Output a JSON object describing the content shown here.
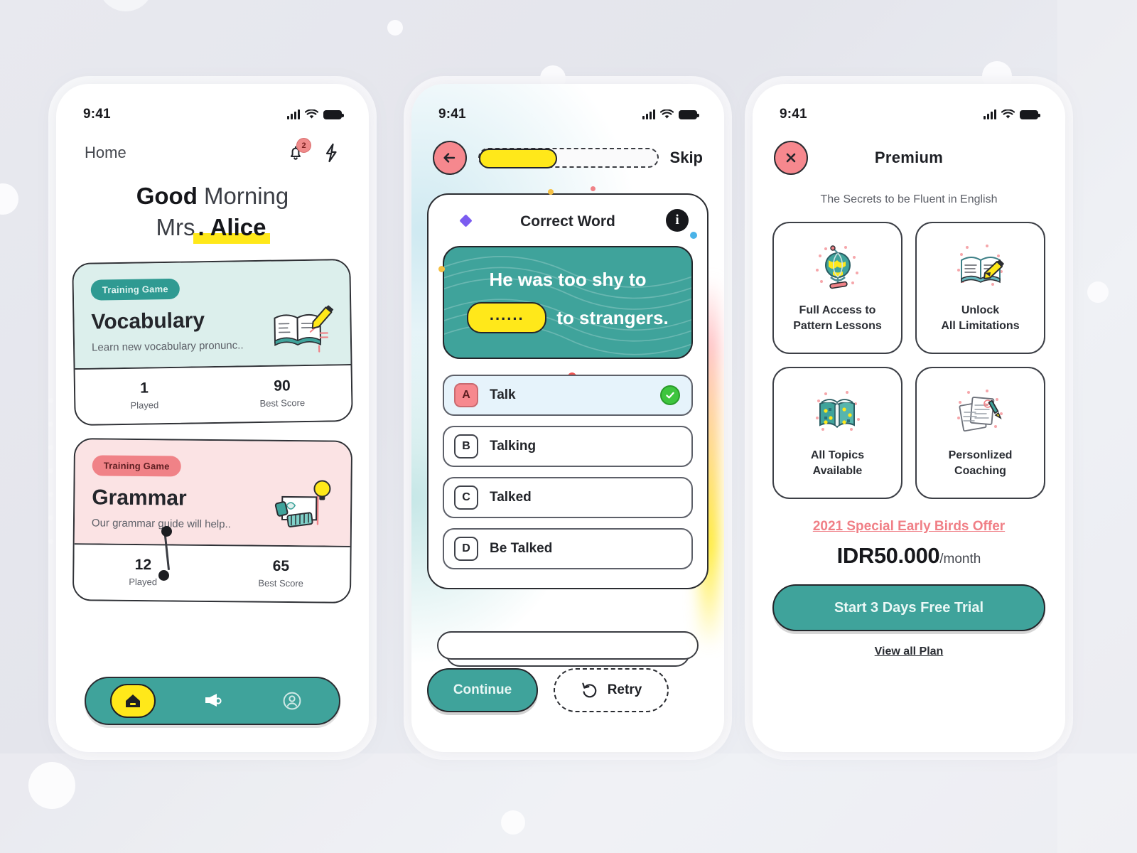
{
  "status_bar": {
    "time": "9:41",
    "signal_icon": "cellular-signal-icon",
    "wifi_icon": "wifi-icon",
    "battery_icon": "battery-icon"
  },
  "phone_home": {
    "nav_label": "Home",
    "notification_badge": "2",
    "bell_icon": "bell-icon",
    "bolt_icon": "lightning-bolt-icon",
    "greeting_line1_bold": "Good",
    "greeting_line1_rest": " Morning",
    "greeting_line2_prefix": "Mrs",
    "greeting_line2_highlight": ". Alice",
    "cards": [
      {
        "pill": "Training Game",
        "title": "Vocabulary",
        "desc": "Learn new vocabulary pronunc..",
        "art_icon": "open-book-pencil-icon",
        "stats": [
          {
            "value": "1",
            "label": "Played"
          },
          {
            "value": "90",
            "label": "Best Score"
          }
        ]
      },
      {
        "pill": "Training Game",
        "title": "Grammar",
        "desc": "Our grammar guide will help..",
        "art_icon": "notes-lightbulb-icon",
        "stats": [
          {
            "value": "12",
            "label": "Played"
          },
          {
            "value": "65",
            "label": "Best Score"
          }
        ]
      }
    ],
    "tabs": [
      {
        "name": "home",
        "icon": "home-icon",
        "active": true
      },
      {
        "name": "announcements",
        "icon": "megaphone-icon",
        "active": false
      },
      {
        "name": "profile",
        "icon": "user-circle-icon",
        "active": false
      }
    ]
  },
  "phone_quiz": {
    "back_icon": "arrow-left-icon",
    "progress_percent": 44,
    "skip_label": "Skip",
    "card_title": "Correct Word",
    "diamond_icon": "diamond-icon",
    "info_icon": "info-icon",
    "sentence_line1": "He was too shy to",
    "sentence_blank": "......",
    "sentence_line2_tail": "to strangers.",
    "options": [
      {
        "letter": "A",
        "text": "Talk",
        "selected": true,
        "correct": true
      },
      {
        "letter": "B",
        "text": "Talking",
        "selected": false,
        "correct": false
      },
      {
        "letter": "C",
        "text": "Talked",
        "selected": false,
        "correct": false
      },
      {
        "letter": "D",
        "text": "Be Talked",
        "selected": false,
        "correct": false
      }
    ],
    "check_icon": "check-circle-icon",
    "continue_label": "Continue",
    "retry_label": "Retry",
    "retry_icon": "undo-arrow-icon"
  },
  "phone_premium": {
    "close_icon": "close-x-icon",
    "title": "Premium",
    "subtitle": "The Secrets to be Fluent in English",
    "features": [
      {
        "icon": "globe-icon",
        "line1": "Full Access to",
        "line2": "Pattern Lessons"
      },
      {
        "icon": "book-pencil-icon",
        "line1": "Unlock",
        "line2": "All Limitations"
      },
      {
        "icon": "open-book-icon",
        "line1": "All Topics",
        "line2": "Available"
      },
      {
        "icon": "papers-pen-icon",
        "line1": "Personlized",
        "line2": "Coaching"
      }
    ],
    "offer": "2021 Special Early Birds Offer",
    "price_amount": "IDR50.000",
    "price_period": "/month",
    "cta_label": "Start 3 Days Free Trial",
    "view_all_label": "View all Plan"
  },
  "colors": {
    "teal": "#3fa39b",
    "yellow": "#ffe81a",
    "pink": "#f6888e",
    "mint_card": "#dcefec",
    "rose_card": "#fbe3e4",
    "green_check": "#3ec53e",
    "purple": "#7b5cf0",
    "ink": "#24262b"
  }
}
